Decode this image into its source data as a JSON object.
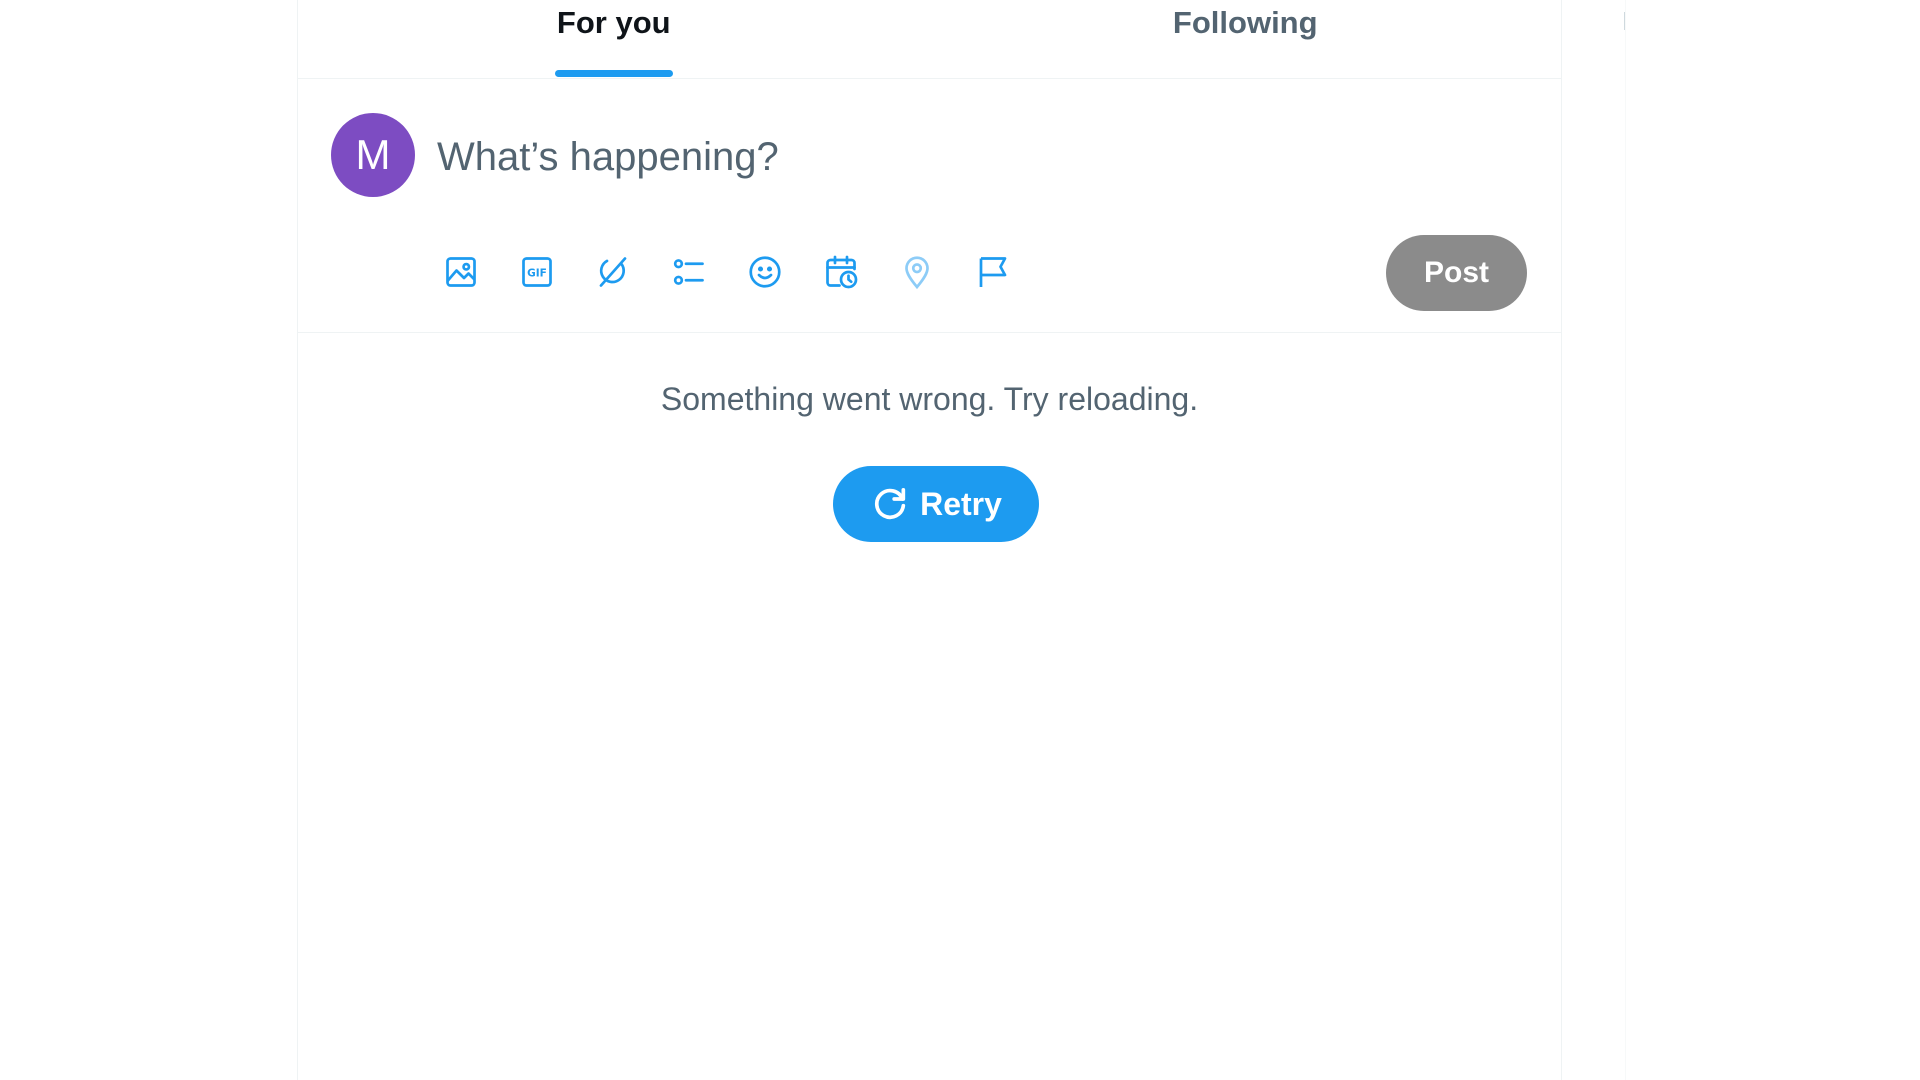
{
  "tabs": [
    {
      "label": "For you",
      "active": true
    },
    {
      "label": "Following",
      "active": false
    }
  ],
  "composer": {
    "avatar_initial": "M",
    "avatar_color": "#7d4cc2",
    "placeholder": "What’s happening?",
    "toolbar_icons": [
      "image-icon",
      "gif-icon",
      "grok-icon",
      "poll-icon",
      "emoji-icon",
      "schedule-icon",
      "location-icon",
      "flag-icon"
    ],
    "post_label": "Post"
  },
  "error": {
    "message": "Something went wrong. Try reloading.",
    "retry_label": "Retry"
  },
  "colors": {
    "accent": "#1d9bf0",
    "post_disabled": "#8b8b8b",
    "secondary_text": "#536471"
  }
}
